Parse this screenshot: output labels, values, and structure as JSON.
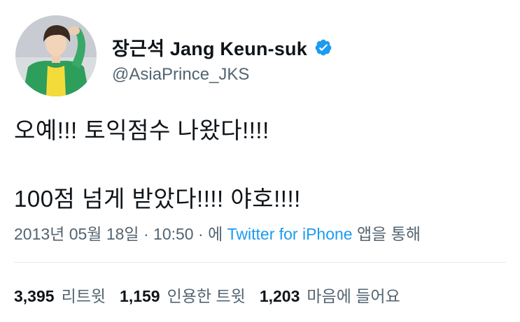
{
  "profile": {
    "display_name": "장근석 Jang Keun-suk",
    "handle": "@AsiaPrince_JKS",
    "verified_icon": "verified-badge-icon"
  },
  "tweet": {
    "line1": "오예!!! 토익점수 나왔다!!!!",
    "line2": "100점 넘게 받았다!!!! 야호!!!!"
  },
  "meta": {
    "date": "2013년 05월 18일",
    "sep1": " · ",
    "time": "10:50",
    "sep2": " · ",
    "prefix": "에 ",
    "source": "Twitter for iPhone",
    "suffix": " 앱을 통해"
  },
  "stats": [
    {
      "num": "3,395",
      "label": "리트윗"
    },
    {
      "num": "1,159",
      "label": "인용한 트윗"
    },
    {
      "num": "1,203",
      "label": "마음에 들어요"
    }
  ],
  "colors": {
    "link": "#1d9bf0",
    "secondary": "#536471",
    "primary": "#0f1419"
  }
}
